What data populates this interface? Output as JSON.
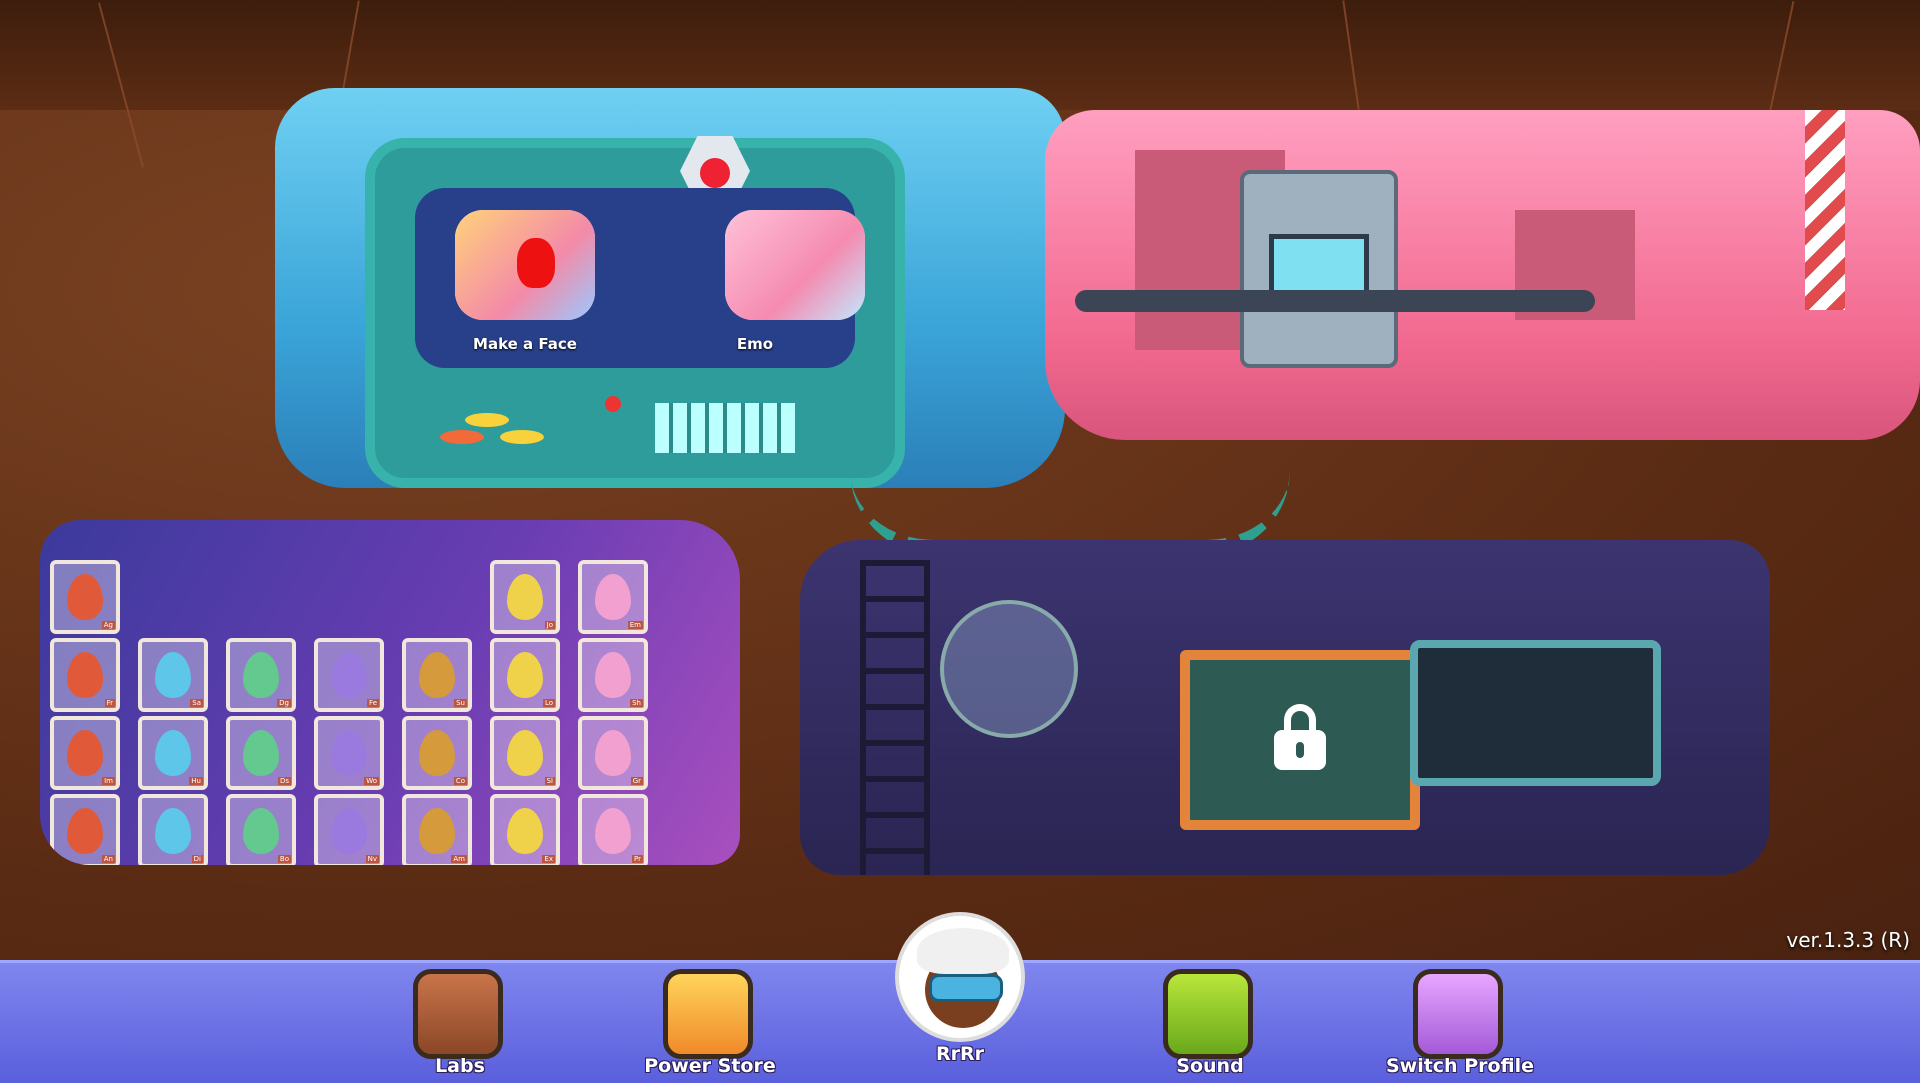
{
  "arcade": {
    "games": [
      {
        "label": "Make a Face"
      },
      {
        "label": "Emo"
      }
    ]
  },
  "eggs": {
    "columns": [
      {
        "color": "#e05a3a",
        "codes": [
          "Ag",
          "Fr",
          "Im",
          "An"
        ]
      },
      {
        "color": "#5ec6e8",
        "codes": [
          "Sa",
          "Hu",
          "Di"
        ]
      },
      {
        "color": "#63c98f",
        "codes": [
          "Dg",
          "Ds",
          "Bo"
        ]
      },
      {
        "color": "#9b7ae0",
        "codes": [
          "Fe",
          "Wo",
          "Nv"
        ]
      },
      {
        "color": "#d59a3c",
        "codes": [
          "Su",
          "Co",
          "Am"
        ]
      },
      {
        "color": "#f0d24a",
        "codes": [
          "Jo",
          "Lo",
          "Sl",
          "Ex"
        ]
      },
      {
        "color": "#f2a0d0",
        "codes": [
          "Em",
          "Sh",
          "Gr",
          "Pr"
        ]
      }
    ]
  },
  "locked_lab": {
    "status": "locked"
  },
  "version": "ver.1.3.3 (R)",
  "nav": {
    "labs": "Labs",
    "power_store": "Power Store",
    "profile_name": "RrRr",
    "sound": "Sound",
    "switch_profile": "Switch Profile"
  },
  "colors": {
    "nav_bar": "#6b71e6",
    "dirt": "#6e3a1f"
  }
}
